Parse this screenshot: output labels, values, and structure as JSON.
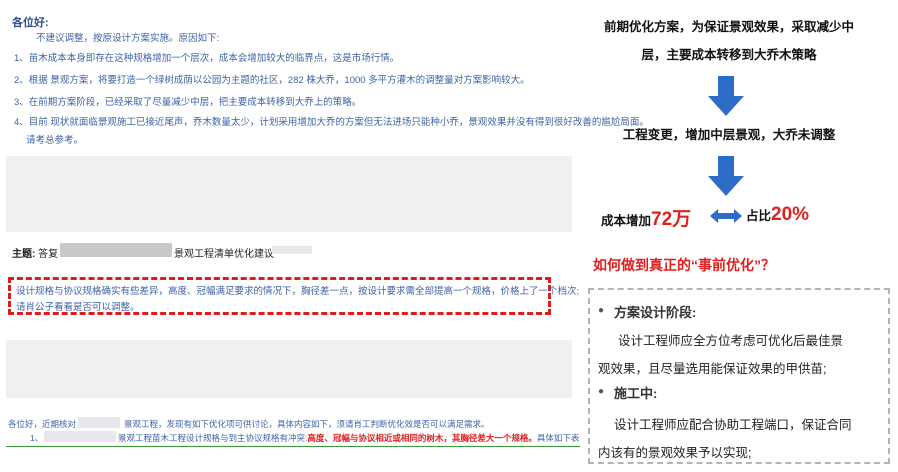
{
  "email": {
    "greeting": "各位好:",
    "intro": "不建议调整，按原设计方案实施。原因如下:",
    "items": [
      "1、苗木成本本身即存在这种规格增加一个层次，成本会增加较大的临界点，这是市场行情。",
      "2、根据          景观方案，将要打造一个绿树成荫以公园为主题的社区，282 株大乔，1000 多平方灌木的调整量对方案影响较大。",
      "3、在前期方案阶段，已经采取了尽量减少中层，把主要成本转移到大乔上的策略。",
      "4、目前      现状就面临景观施工已接近尾声，乔木数量太少，计划采用增加大乔的方案但无法进场只能种小乔，景观效果并没有得到很好改善的尴尬局面。",
      "请考总参考。"
    ]
  },
  "subject": {
    "label": "主题:",
    "text_left": "答复",
    "text_right": "景观工程清单优化建议"
  },
  "dashed_note": {
    "line1": "设计规格与协议规格确实有些差异，高度、冠幅满足要求的情况下，胸径差一点，按设计要求需全部提高一个规格，价格上了一个档次;",
    "line2": "请肖公子看看是否可以调整。"
  },
  "bottom_email": {
    "line1_left": "各位好，近期核对",
    "line1_right": "景观工程，发现有如下优化项可供讨论，具体内容如下，须请肖工判断优化效是否可以满足需求。",
    "line2_num": "1、",
    "line2_blue": "景观工程苗木工程设计规格与到主协议规格有冲突:",
    "line2_red": "高度、冠幅与协议相近或相同的树木，其胸径差大一个规格。",
    "line2_tail": "具体如下表"
  },
  "flow": {
    "step1_line1": "前期优化方案，为保证景观效果，采取减少中",
    "step1_line2": "层，主要成本转移到大乔木策略",
    "step2": "工程变更，增加中层景观，大乔未调整",
    "cost_prefix": "成本增加",
    "cost_value": "72万",
    "ratio_prefix": "占比",
    "ratio_value": "20%"
  },
  "question": "如何做到真正的“事前优化”？",
  "panel": {
    "sec1_title": "方案设计阶段:",
    "sec1_line1": "设计工程师应全方位考虑可优化后最佳景",
    "sec1_line2": "观效果，且尽量选用能保证效果的甲供苗;",
    "sec2_title": "施工中:",
    "sec2_line1": "设计工程师应配合协助工程端口，保证合同",
    "sec2_line2": "内该有的景观效果予以实现;"
  },
  "colors": {
    "accent_red": "#e02020",
    "arrow_blue": "#2d6cc7",
    "email_blue": "#3d63a8"
  }
}
